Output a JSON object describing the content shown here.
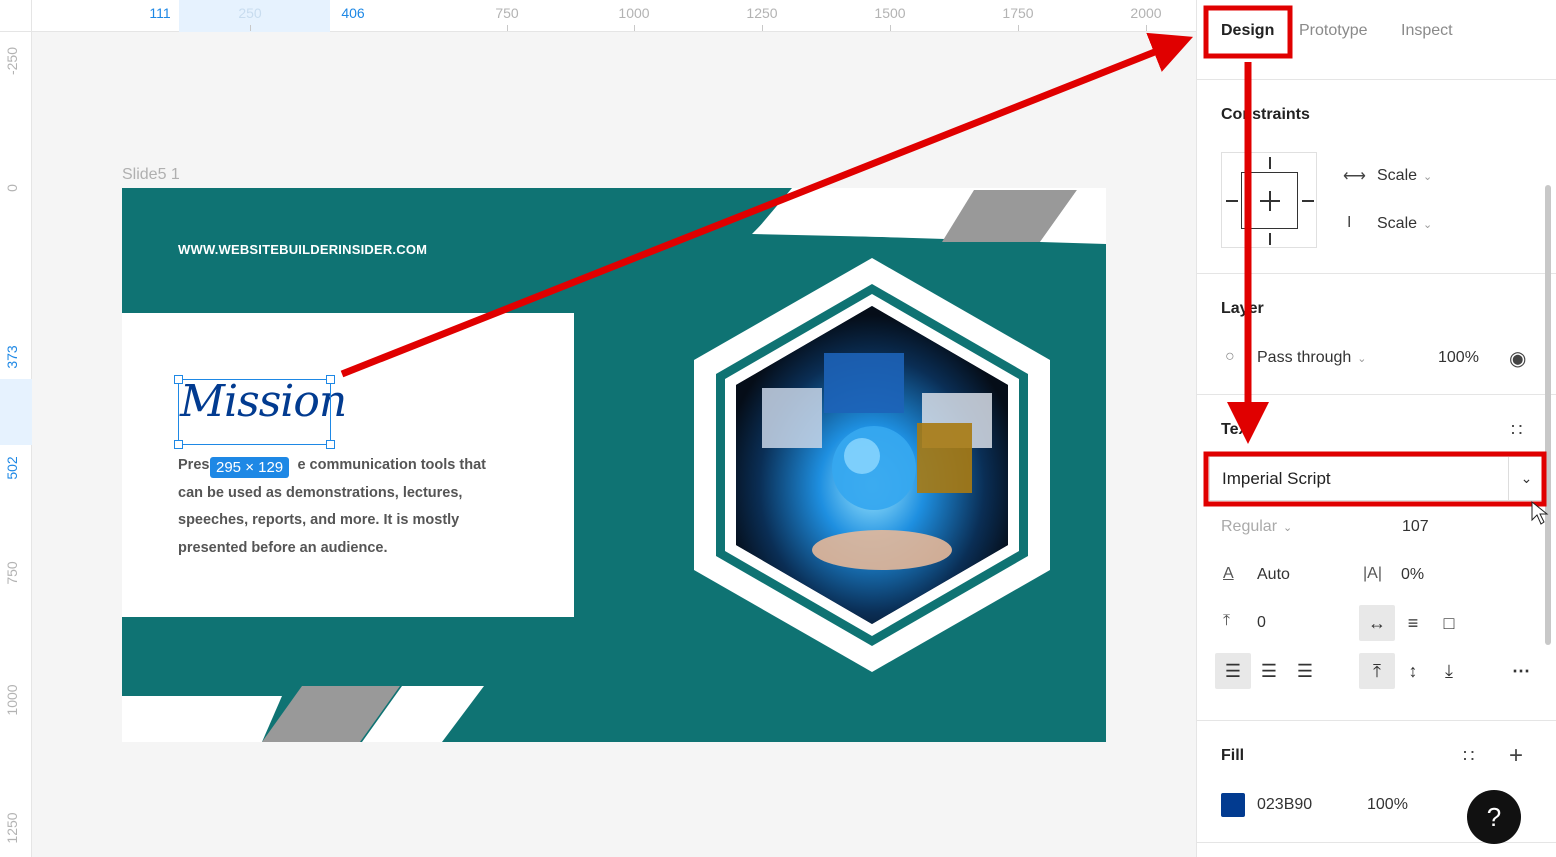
{
  "ruler": {
    "top_ticks": [
      "111",
      "250",
      "406",
      "750",
      "1000",
      "1250",
      "1500",
      "1750",
      "2000"
    ],
    "left_ticks": [
      "-250",
      "0",
      "373",
      "502",
      "750",
      "1000",
      "1250"
    ]
  },
  "canvas": {
    "frame_label": "Slide5 1",
    "slide": {
      "url": "WWW.WEBSITEBUILDERINSIDER.COM",
      "heading": "Mission",
      "body_before": "Pres",
      "body_after": "e communication tools that can be used as demonstrations, lectures, speeches, reports, and more. It is mostly presented before an audience."
    },
    "selection_size": "295 × 129"
  },
  "panel": {
    "tabs": [
      "Design",
      "Prototype",
      "Inspect"
    ],
    "constraints": {
      "title": "Constraints",
      "horizontal": "Scale",
      "vertical": "Scale"
    },
    "layer": {
      "title": "Layer",
      "blend": "Pass through",
      "opacity": "100%"
    },
    "text": {
      "title": "Text",
      "font": "Imperial Script",
      "weight": "Regular",
      "size": "107",
      "line_height": "Auto",
      "letter_spacing": "0%",
      "paragraph_spacing": "0"
    },
    "fill": {
      "title": "Fill",
      "hex": "023B90",
      "opacity": "100%",
      "color": "#023b90"
    }
  },
  "help": "?"
}
